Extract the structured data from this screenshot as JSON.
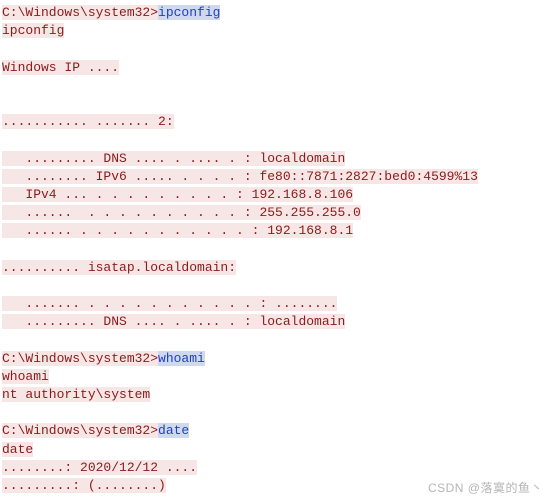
{
  "session": {
    "prompt": "C:\\Windows\\system32>",
    "blocks": [
      {
        "type": "cmd",
        "command": "ipconfig",
        "echo": "ipconfig"
      },
      {
        "type": "gap"
      },
      {
        "type": "out",
        "text": "Windows IP ...."
      },
      {
        "type": "gap2"
      },
      {
        "type": "out",
        "text": "........... ....... 2:"
      },
      {
        "type": "gap"
      },
      {
        "type": "out",
        "text": "   ......... DNS .... . .... . : localdomain"
      },
      {
        "type": "out",
        "text": "   ........ IPv6 ..... . . . . : fe80::7871:2827:bed0:4599%13"
      },
      {
        "type": "out",
        "text": "   IPv4 ... . . . . . . . . . : 192.168.8.106"
      },
      {
        "type": "out",
        "text": "   ......  . . . . . . . . . . : 255.255.255.0"
      },
      {
        "type": "out",
        "text": "   ...... . . . . . . . . . . . : 192.168.8.1"
      },
      {
        "type": "gap"
      },
      {
        "type": "out",
        "text": ".......... isatap.localdomain:"
      },
      {
        "type": "gap"
      },
      {
        "type": "out",
        "text": "   ....... . . . . . . . . . . . : ........"
      },
      {
        "type": "out",
        "text": "   ......... DNS .... . .... . : localdomain"
      },
      {
        "type": "gap"
      },
      {
        "type": "cmd",
        "command": "whoami",
        "echo": "whoami"
      },
      {
        "type": "out",
        "text": "nt authority\\system"
      },
      {
        "type": "gap"
      },
      {
        "type": "cmd",
        "command": "date",
        "echo": "date"
      },
      {
        "type": "out",
        "text": "........: 2020/12/12 ...."
      },
      {
        "type": "out",
        "text": ".........: (........)"
      }
    ]
  },
  "watermark": "CSDN @落寞的鱼丶"
}
